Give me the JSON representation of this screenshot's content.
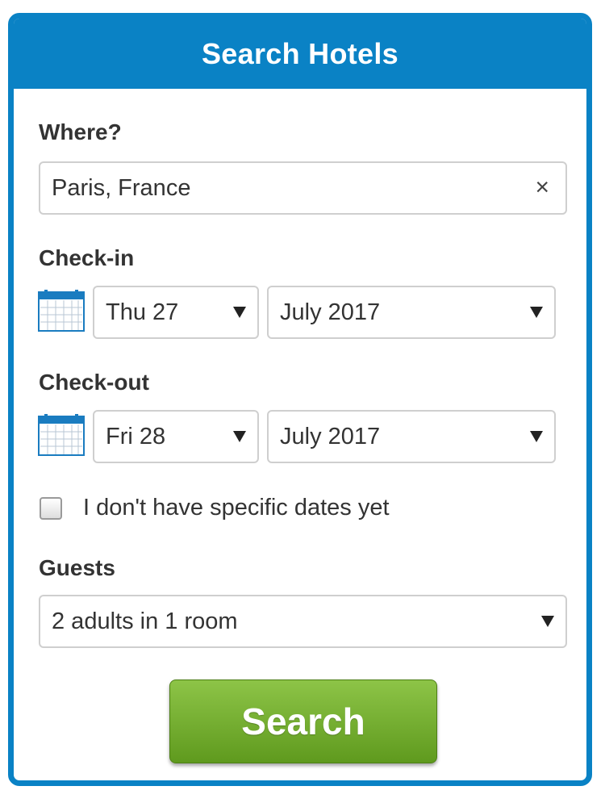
{
  "header": {
    "title": "Search Hotels"
  },
  "where": {
    "label": "Where?",
    "value": "Paris, France",
    "clear_glyph": "×"
  },
  "checkin": {
    "label": "Check-in",
    "day": "Thu 27",
    "month": "July 2017"
  },
  "checkout": {
    "label": "Check-out",
    "day": "Fri 28",
    "month": "July 2017"
  },
  "no_dates": {
    "label": "I don't have specific dates yet",
    "checked": false
  },
  "guests": {
    "label": "Guests",
    "value": "2 adults in 1 room"
  },
  "search_button": {
    "label": "Search"
  },
  "colors": {
    "brand_blue": "#0a82c5",
    "button_green_top": "#8dc447",
    "button_green_bottom": "#5f9a1e"
  },
  "icons": [
    "calendar-icon",
    "close-icon",
    "dropdown-arrow-icon",
    "checkbox-icon"
  ]
}
